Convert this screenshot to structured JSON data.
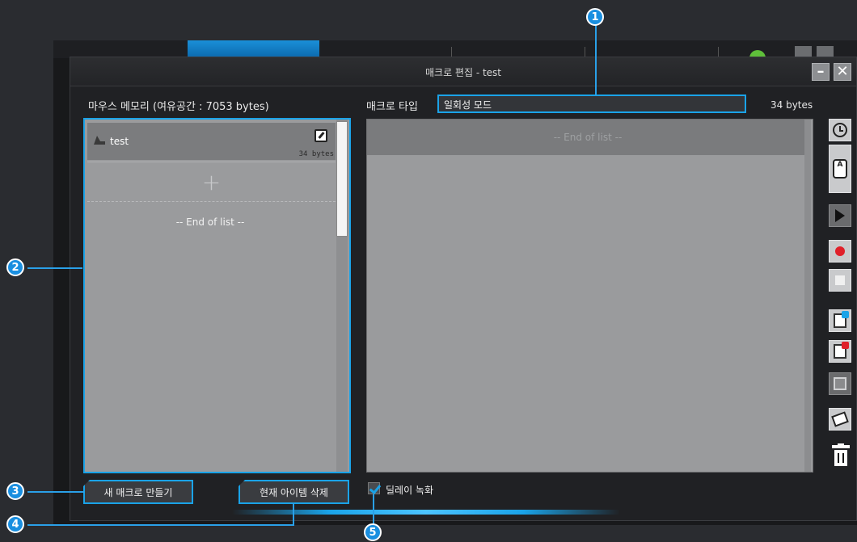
{
  "dialog": {
    "title": "매크로 편집 - test",
    "minimize_glyph": "–",
    "close_glyph": "✕"
  },
  "memory": {
    "label": "마우스 메모리 (여유공간 : 7053 bytes)"
  },
  "macro_type": {
    "label": "매크로 타입",
    "value": "일회성 모드"
  },
  "size_label": "34 bytes",
  "macro_list": {
    "items": [
      {
        "name": "test",
        "size": "34 bytes"
      }
    ],
    "add_glyph": "+",
    "end_text": "-- End of list --"
  },
  "macro_steps": {
    "end_text": "-- End of list --"
  },
  "toolbar": {
    "icons": [
      "clock-icon",
      "keyboard-mouse-icon",
      "play-icon",
      "record-icon",
      "stop-icon",
      "copy-icon",
      "paste-icon",
      "save-icon",
      "eraser-icon",
      "trash-icon"
    ]
  },
  "buttons": {
    "new_macro": "새 매크로 만들기",
    "delete_item": "현재 아이템 삭제"
  },
  "delay_record": {
    "label": "딜레이 녹화",
    "checked": true
  },
  "callouts": [
    "1",
    "2",
    "3",
    "4",
    "5"
  ],
  "colors": {
    "accent": "#1aa3e8",
    "record": "#e0202a",
    "panel": "#9a9b9d"
  }
}
